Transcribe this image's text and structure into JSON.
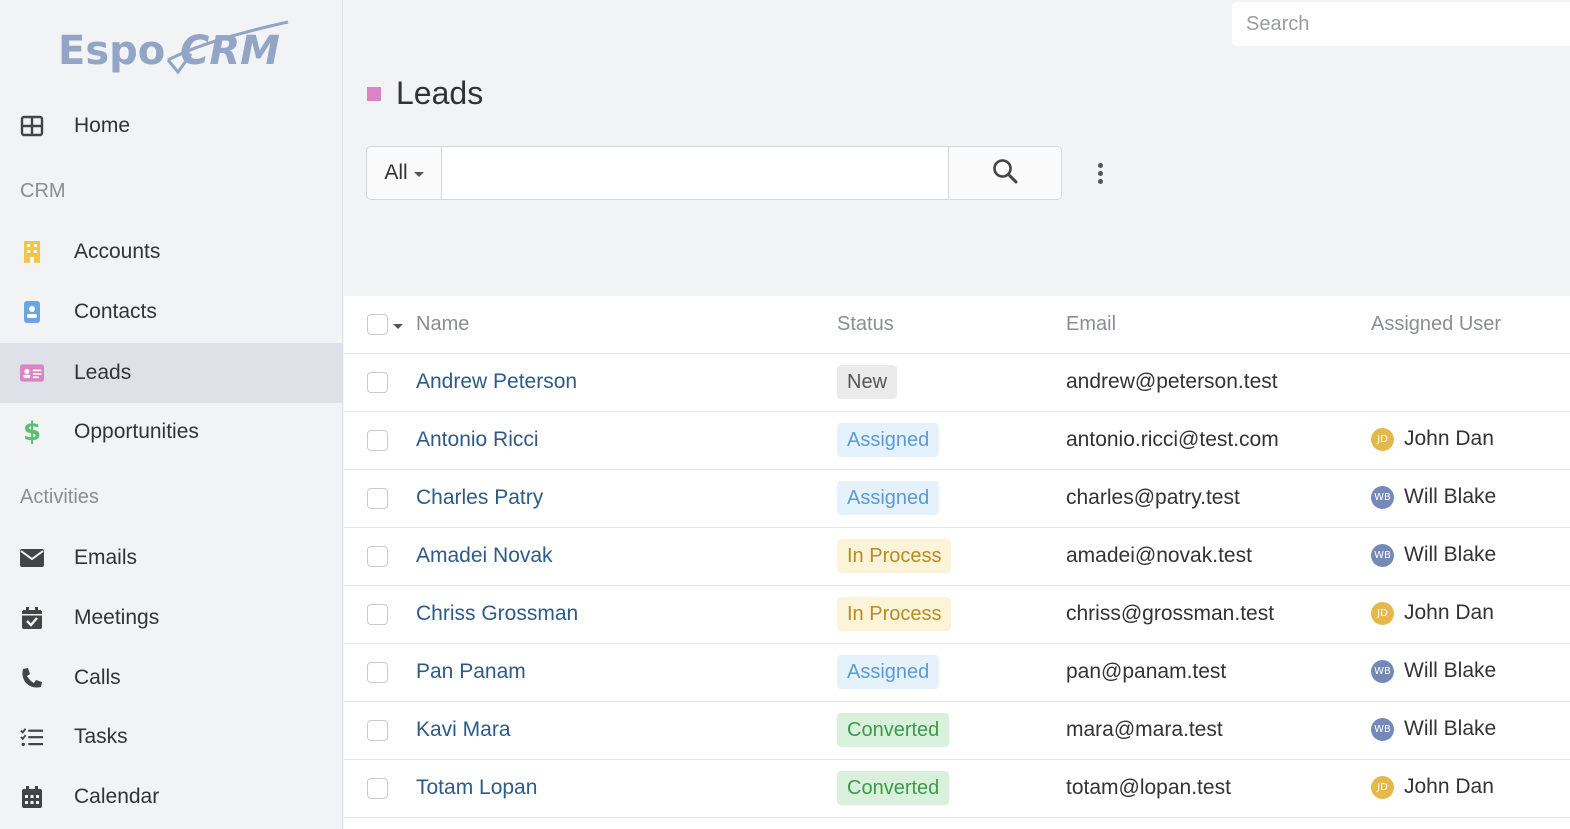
{
  "app": {
    "logo_text": "EspoCRM"
  },
  "top_search": {
    "placeholder": "Search"
  },
  "sidebar": {
    "home": {
      "label": "Home",
      "icon": "grid-icon"
    },
    "groups": [
      {
        "label": "CRM",
        "items": [
          {
            "label": "Accounts",
            "icon": "building-icon",
            "color": "#f0c64a"
          },
          {
            "label": "Contacts",
            "icon": "contact-card-icon",
            "color": "#6ba6e0"
          },
          {
            "label": "Leads",
            "icon": "id-card-icon",
            "color": "#da84c6",
            "active": true
          },
          {
            "label": "Opportunities",
            "icon": "dollar-icon",
            "color": "#5cbf72"
          }
        ]
      },
      {
        "label": "Activities",
        "items": [
          {
            "label": "Emails",
            "icon": "envelope-icon"
          },
          {
            "label": "Meetings",
            "icon": "calendar-check-icon"
          },
          {
            "label": "Calls",
            "icon": "phone-icon"
          },
          {
            "label": "Tasks",
            "icon": "tasks-icon"
          },
          {
            "label": "Calendar",
            "icon": "calendar-icon"
          }
        ]
      }
    ]
  },
  "header": {
    "title": "Leads",
    "accent": "#da84c6"
  },
  "filter": {
    "scope": "All",
    "query": ""
  },
  "table": {
    "columns": [
      "Name",
      "Status",
      "Email",
      "Assigned User"
    ],
    "rows": [
      {
        "name": "Andrew Peterson",
        "status": "New",
        "email": "andrew@peterson.test",
        "user": "",
        "initials": ""
      },
      {
        "name": "Antonio Ricci",
        "status": "Assigned",
        "email": "antonio.ricci@test.com",
        "user": "John Dan",
        "initials": "JD"
      },
      {
        "name": "Charles Patry",
        "status": "Assigned",
        "email": "charles@patry.test",
        "user": "Will Blake",
        "initials": "WB"
      },
      {
        "name": "Amadei Novak",
        "status": "In Process",
        "email": "amadei@novak.test",
        "user": "Will Blake",
        "initials": "WB"
      },
      {
        "name": "Chriss Grossman",
        "status": "In Process",
        "email": "chriss@grossman.test",
        "user": "John Dan",
        "initials": "JD"
      },
      {
        "name": "Pan Panam",
        "status": "Assigned",
        "email": "pan@panam.test",
        "user": "Will Blake",
        "initials": "WB"
      },
      {
        "name": "Kavi Mara",
        "status": "Converted",
        "email": "mara@mara.test",
        "user": "Will Blake",
        "initials": "WB"
      },
      {
        "name": "Totam Lopan",
        "status": "Converted",
        "email": "totam@lopan.test",
        "user": "John Dan",
        "initials": "JD"
      }
    ]
  }
}
